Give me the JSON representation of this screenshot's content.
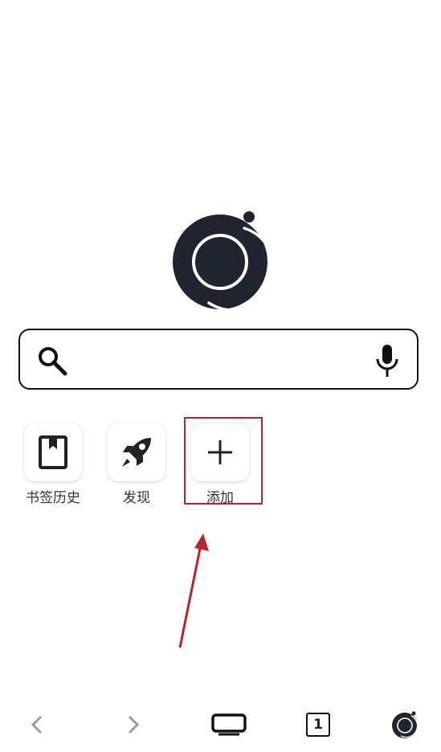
{
  "colors": {
    "dark": "#1e2430",
    "accent_red": "#b3262c",
    "icon_gray": "#9a9a9a"
  },
  "logo": {
    "icon": "camera-lens-logo-icon"
  },
  "search": {
    "value": "",
    "placeholder": "",
    "search_icon": "search-icon",
    "mic_icon": "microphone-icon"
  },
  "shortcuts": [
    {
      "label": "书签历史",
      "icon": "bookmark-book-icon"
    },
    {
      "label": "发现",
      "icon": "rocket-icon"
    },
    {
      "label": "添加",
      "icon": "plus-icon"
    }
  ],
  "bottom_bar": {
    "back_icon": "chevron-left-icon",
    "forward_icon": "chevron-right-icon",
    "windows_icon": "screen-icon",
    "tab_count": "1",
    "home_icon": "browser-logo-icon"
  }
}
